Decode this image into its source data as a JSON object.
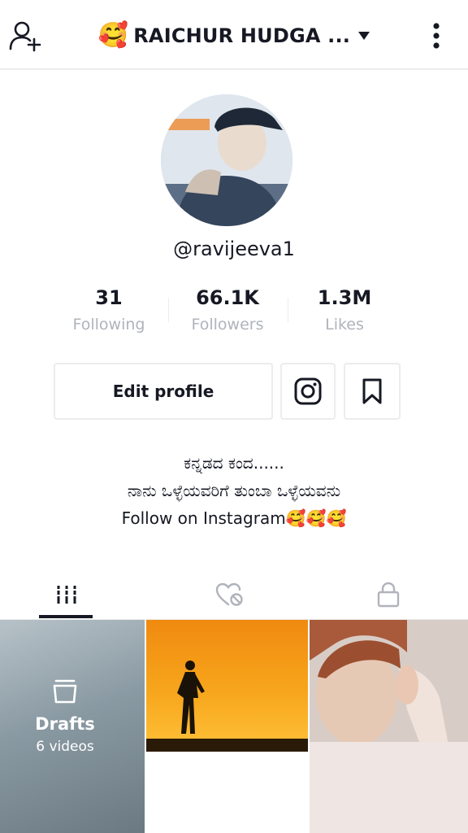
{
  "header": {
    "title_emoji": "🥰",
    "title": "RAICHUR HUDGA ...",
    "add_user_icon": "add-user-icon",
    "more_icon": "more-vertical-icon"
  },
  "profile": {
    "username": "@ravijeeva1",
    "stats": [
      {
        "value": "31",
        "label": "Following"
      },
      {
        "value": "66.1K",
        "label": "Followers"
      },
      {
        "value": "1.3M",
        "label": "Likes"
      }
    ],
    "edit_profile_label": "Edit profile",
    "bio": [
      "ಕನ್ನಡದ ಕಂದ......",
      "ನಾನು ಒಳ್ಳೆಯವರಿಗೆ ತುಂಬಾ ಒಳ್ಳೆಯವನು",
      "Follow on Instagram🥰🥰🥰"
    ]
  },
  "tabs": [
    {
      "icon": "grid-icon"
    },
    {
      "icon": "liked-hidden-icon"
    },
    {
      "icon": "lock-icon"
    }
  ],
  "grid": {
    "drafts_title": "Drafts",
    "drafts_count": "6 videos"
  },
  "colors": {
    "text": "#161823",
    "muted": "#b0b3bb",
    "border": "#ececec",
    "sunset": "#f7a61c"
  }
}
